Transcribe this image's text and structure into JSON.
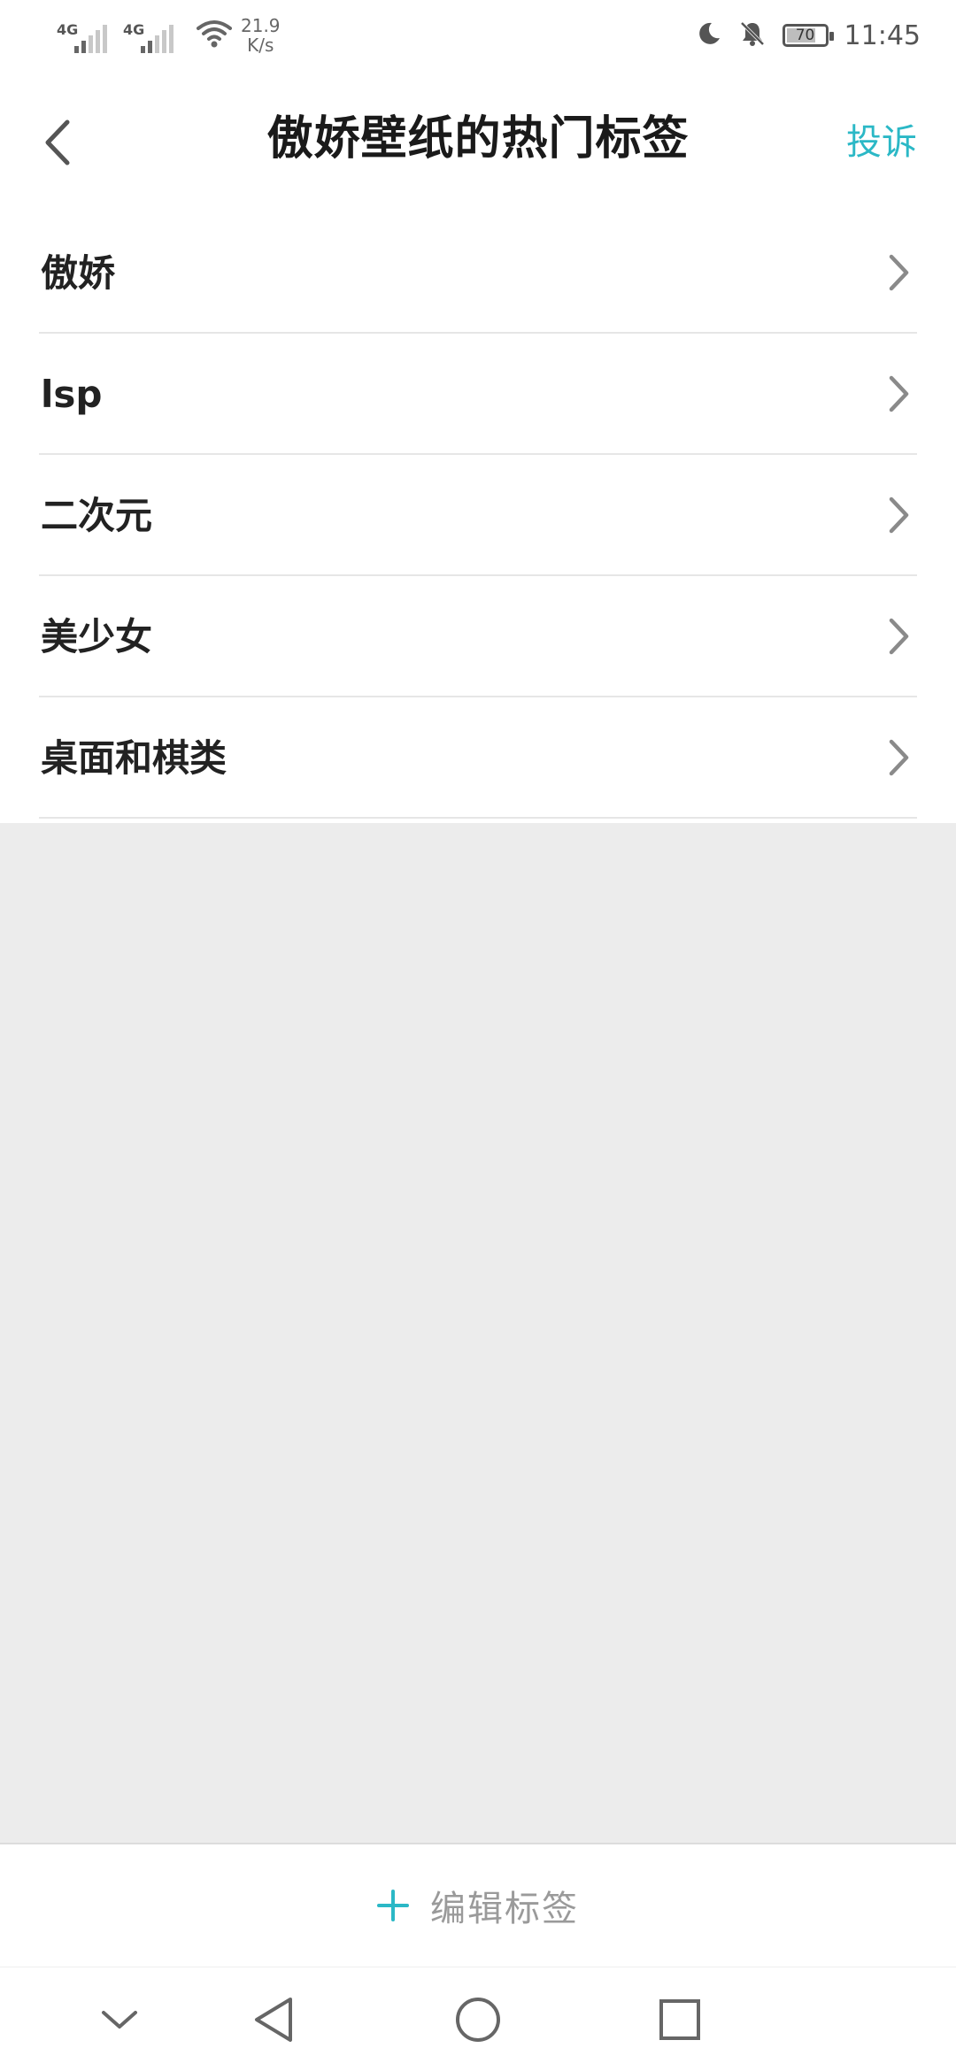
{
  "status_bar": {
    "network_1": "4G",
    "network_2": "4G",
    "speed_value": "21.9",
    "speed_unit": "K/s",
    "battery_level": "70",
    "time": "11:45",
    "icons": [
      "signal-icon",
      "signal-icon",
      "wifi-icon",
      "moon-icon",
      "bell-muted-icon",
      "battery-icon"
    ]
  },
  "header": {
    "title": "傲娇壁纸的热门标签",
    "report_label": "投诉",
    "back_icon": "chevron-left-icon"
  },
  "tags": [
    {
      "label": "傲娇"
    },
    {
      "label": "lsp"
    },
    {
      "label": "二次元"
    },
    {
      "label": "美少女"
    },
    {
      "label": "桌面和棋类"
    }
  ],
  "edit_bar": {
    "label": "编辑标签",
    "icon": "plus-icon"
  },
  "nav_bar": {
    "icons": [
      "chevron-down-icon",
      "back-triangle-icon",
      "home-circle-icon",
      "recents-square-icon"
    ]
  },
  "colors": {
    "accent": "#2bb8c6",
    "background": "#ececec",
    "surface": "#ffffff",
    "divider": "#e6e6e6"
  }
}
